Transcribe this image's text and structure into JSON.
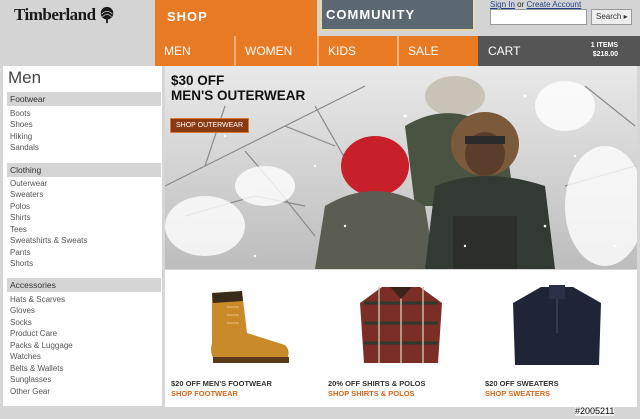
{
  "header": {
    "brand": "Timberland",
    "shop_tab": "SHOP",
    "community_tab": "COMMUNITY",
    "nav": [
      "MEN",
      "WOMEN",
      "KIDS",
      "SALE"
    ],
    "cart_label": "CART",
    "cart_items": "1 ITEMS",
    "cart_total": "$218.00",
    "sign_in": "Sign In",
    "or": "or",
    "create_account": "Create Account",
    "search_placeholder": "",
    "search_button": "Search ▸"
  },
  "sidebar": {
    "title": "Men",
    "sections": [
      {
        "heading": "Footwear",
        "links": [
          "Boots",
          "Shoes",
          "Hiking",
          "Sandals"
        ]
      },
      {
        "heading": "Clothing",
        "links": [
          "Outerwear",
          "Sweaters",
          "Polos",
          "Shirts",
          "Tees",
          "Sweatshirts & Sweats",
          "Pants",
          "Shorts"
        ]
      },
      {
        "heading": "Accessories",
        "links": [
          "Hats & Scarves",
          "Gloves",
          "Socks",
          "Product Care",
          "Packs & Luggage",
          "Watches",
          "Belts & Wallets",
          "Sunglasses",
          "Other Gear"
        ]
      }
    ]
  },
  "hero": {
    "title_line1": "$30 OFF",
    "title_line2": "MEN'S OUTERWEAR",
    "button": "SHOP OUTERWEAR"
  },
  "products": [
    {
      "promo": "$20 OFF MEN'S FOOTWEAR",
      "link": "SHOP FOOTWEAR",
      "icon": "boot-icon"
    },
    {
      "promo": "20% OFF SHIRTS & POLOS",
      "link": "SHOP SHIRTS & POLOS",
      "icon": "plaid-shirt-icon"
    },
    {
      "promo": "$20 OFF SWEATERS",
      "link": "SHOP SWEATERS",
      "icon": "sweater-icon"
    }
  ],
  "watermark": "#2005211",
  "colors": {
    "accent": "#e87a24",
    "community": "#5b6872",
    "link_orange": "#d2691e"
  }
}
